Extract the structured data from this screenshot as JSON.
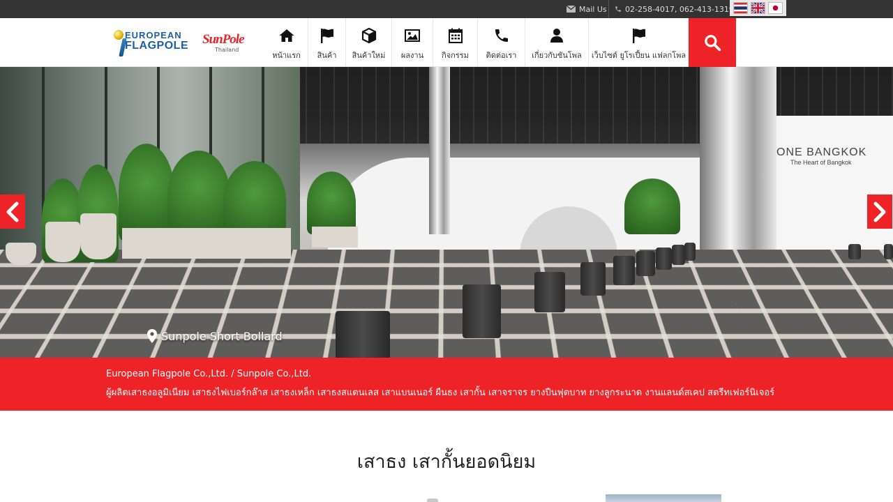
{
  "topbar": {
    "mail_label": "Mail Us",
    "phone": "02-258-4017, 062-413-1319",
    "languages": [
      "th",
      "en",
      "ja"
    ]
  },
  "header": {
    "logo_brand_line1": "EUROPEAN",
    "logo_brand_line2": "FLAGPOLE",
    "logo_sunpole": "SunPole",
    "logo_sunpole_sub": "Thailand",
    "nav": [
      {
        "label": "หน้าแรก",
        "icon": "home-icon"
      },
      {
        "label": "สินค้า",
        "icon": "flag-icon"
      },
      {
        "label": "สินค้าใหม่",
        "icon": "cube-icon"
      },
      {
        "label": "ผลงาน",
        "icon": "image-icon"
      },
      {
        "label": "กิจกรรม",
        "icon": "calendar-icon"
      },
      {
        "label": "ติดต่อเรา",
        "icon": "phone-icon"
      },
      {
        "label": "เกี่ยวกับซันโพล",
        "icon": "user-icon"
      },
      {
        "label": "เว็บไซต์ ยูโรเปี้ยน แฟลกโพล",
        "icon": "flag-icon"
      }
    ],
    "search_icon": "search-icon"
  },
  "hero": {
    "caption": "Sunpole Short Bollard",
    "sign_title": "ONE BANGKOK",
    "sign_subtitle": "The Heart of Bangkok"
  },
  "band": {
    "company": "European Flagpole Co.,Ltd. / Sunpole Co.,Ltd.",
    "products": "ผู้ผลิตเสาธงอลูมิเนียม เสาธงไฟเบอร์กล๊าส เสาธงเหล็ก เสาธงสแตนเลส เสาแบนเนอร์ ผืนธง เสากั้น เสาจราจร ยางปืนฟุตบาท ยางลูกระนาด งานแลนด์สเคป สตรีทเฟอร์นิเจอร์"
  },
  "section": {
    "title": "เสาธง เสากั้นยอดนิยม"
  },
  "colors": {
    "accent": "#ee2328",
    "topbar": "#333333"
  }
}
